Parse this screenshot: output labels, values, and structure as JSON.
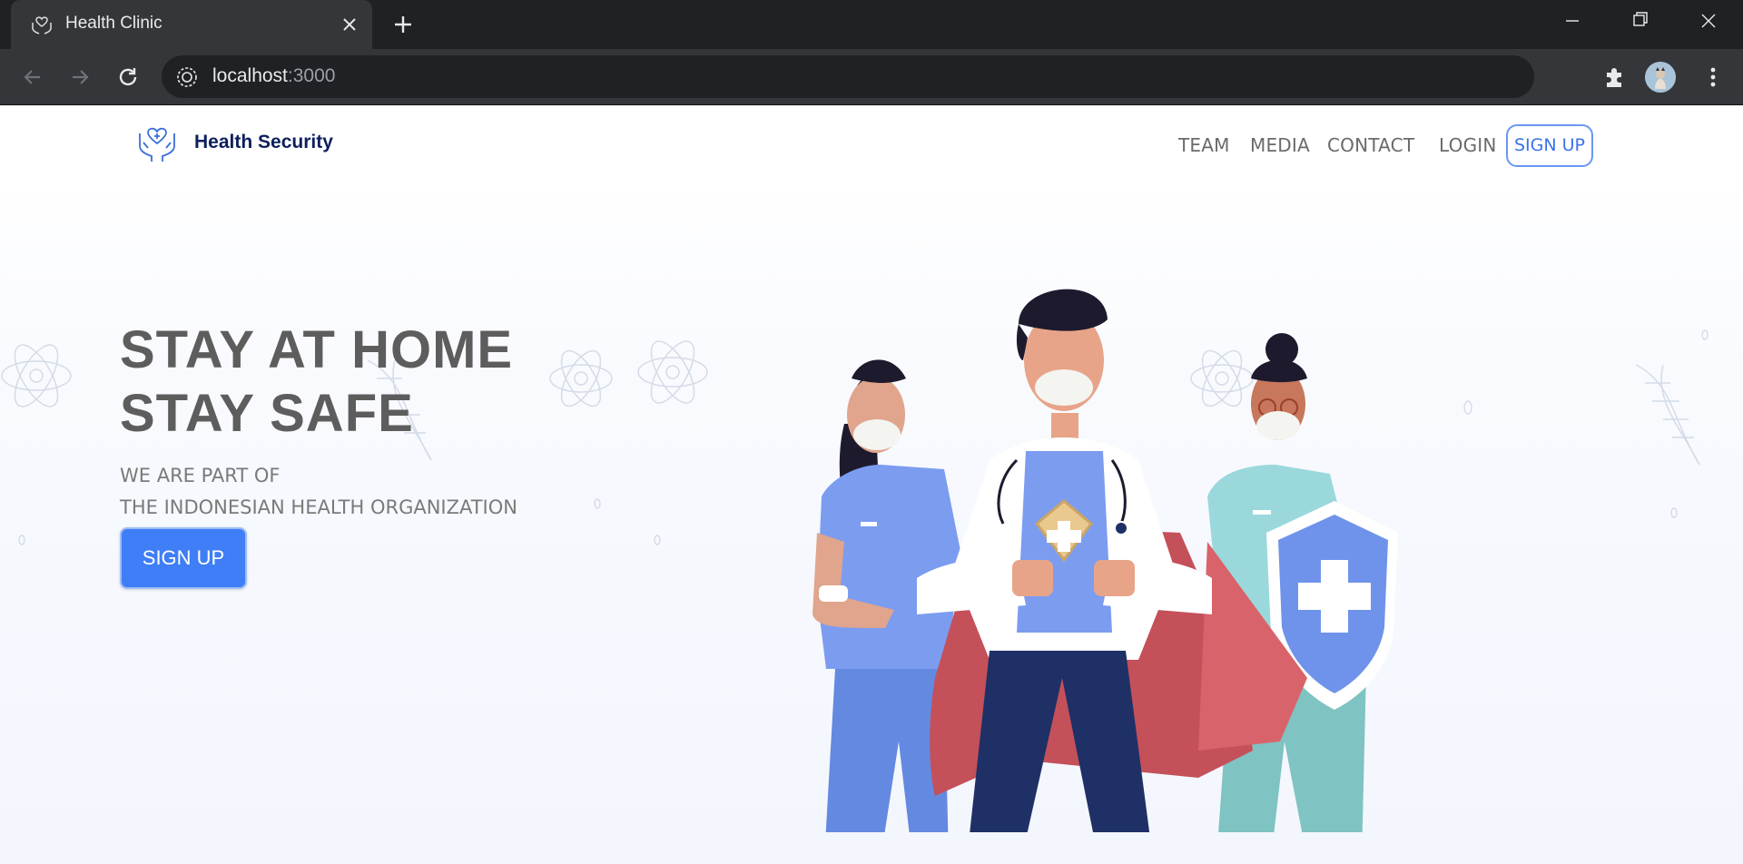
{
  "browser": {
    "tab_title": "Health Clinic",
    "url_host": "localhost",
    "url_port": ":3000"
  },
  "header": {
    "brand": "Health Security",
    "nav": {
      "team": "TEAM",
      "media": "MEDIA",
      "contact": "CONTACT",
      "login": "LOGIN",
      "signup": "SIGN UP"
    }
  },
  "hero": {
    "title_line1": "STAY AT HOME",
    "title_line2": "STAY SAFE",
    "subtitle_line1": "WE ARE PART OF",
    "subtitle_line2": "THE INDONESIAN HEALTH ORGANIZATION",
    "cta": "SIGN UP"
  },
  "colors": {
    "accent": "#3f7ef6",
    "brand_text": "#0d1f5c",
    "nav_text": "#6a6a6a",
    "title_text": "#5d5d5d"
  },
  "icons": [
    "heart-hands-icon",
    "close-icon",
    "plus-icon",
    "back-arrow-icon",
    "forward-arrow-icon",
    "reload-icon",
    "site-info-icon",
    "extensions-icon",
    "profile-avatar",
    "kebab-menu-icon"
  ]
}
